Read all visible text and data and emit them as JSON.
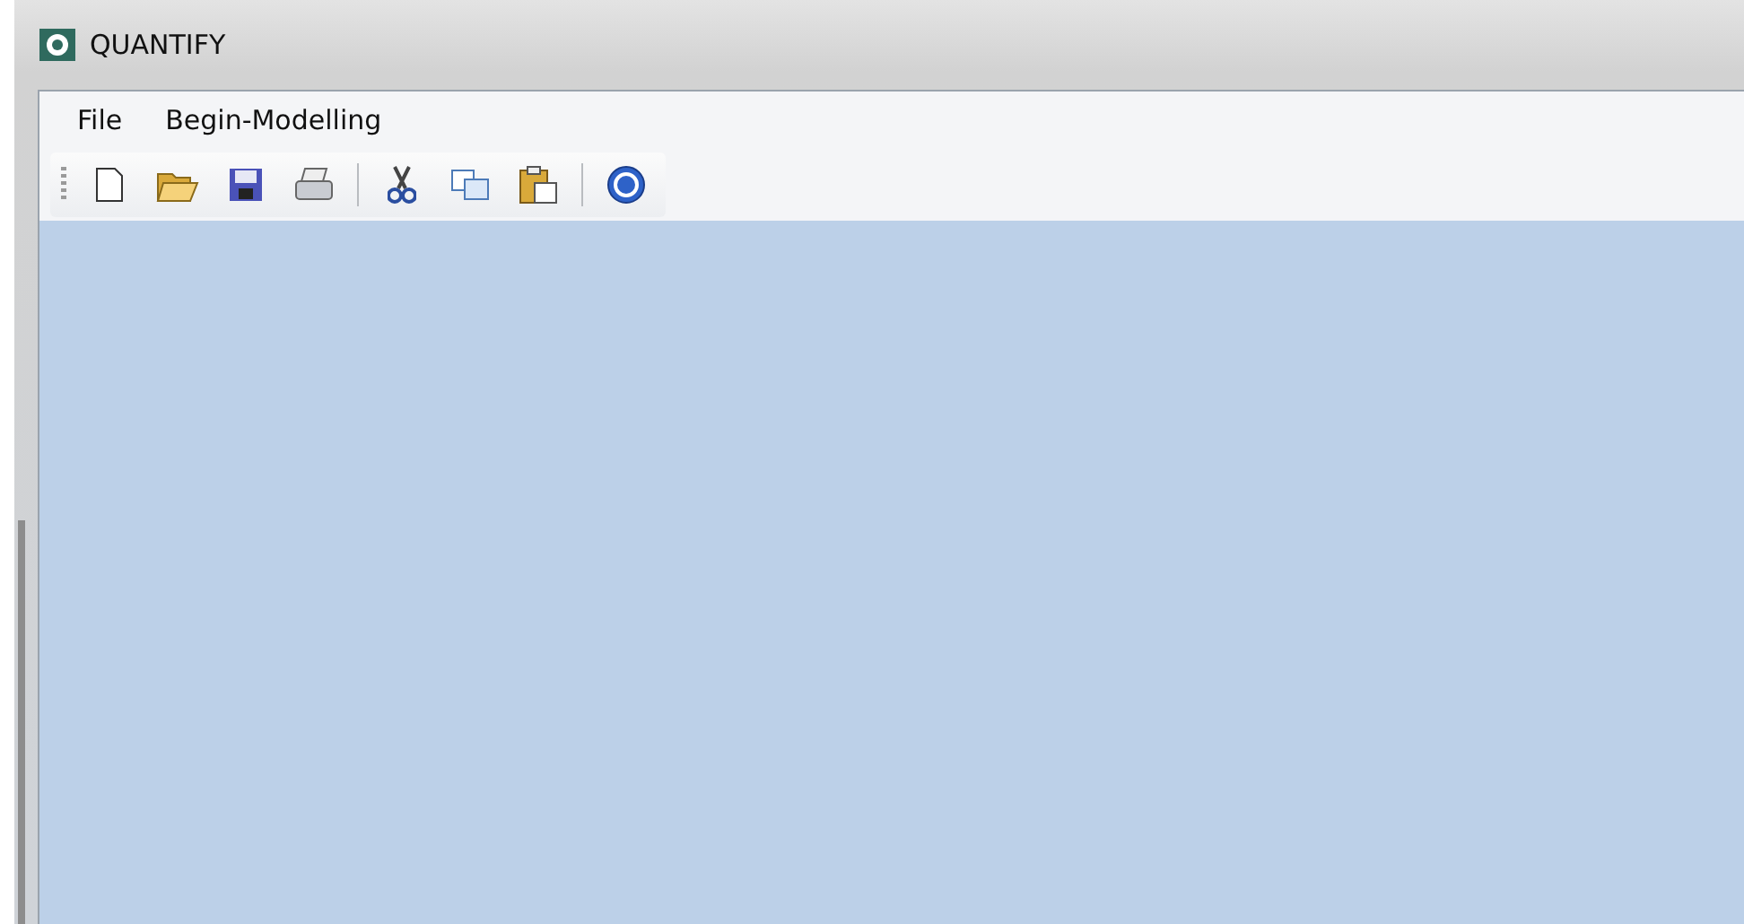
{
  "window": {
    "title": "QUANTIFY"
  },
  "menu": [
    "File",
    "Begin-Modelling"
  ]
}
